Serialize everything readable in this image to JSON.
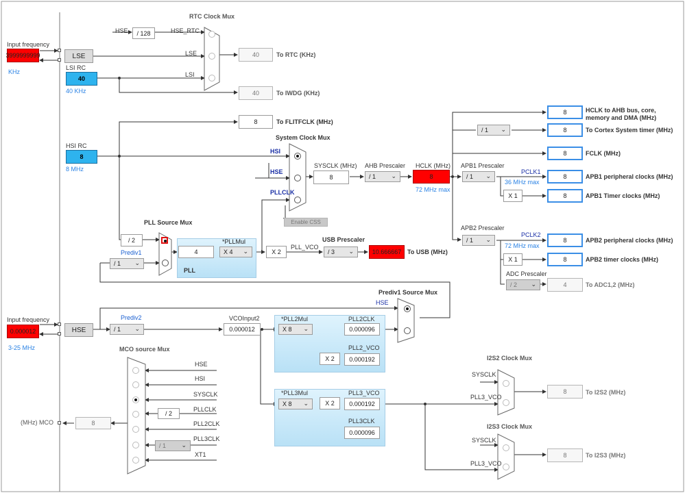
{
  "rtc_mux": {
    "title": "RTC Clock Mux",
    "hse_label": "HSE",
    "hse_div": "/ 128",
    "in_hse_rtc": "HSE_RTC",
    "in_lse": "LSE",
    "in_lsi": "LSI"
  },
  "lse_input": {
    "label": "Input frequency",
    "value": "3999999999",
    "unit": "KHz"
  },
  "lse": {
    "name": "LSE"
  },
  "lsi": {
    "label": "LSI RC",
    "value": "40",
    "freq": "40 KHz"
  },
  "to_rtc": {
    "value": "40",
    "label": "To RTC (KHz)"
  },
  "to_iwdg": {
    "value": "40",
    "label": "To IWDG (KHz)"
  },
  "to_flitf": {
    "value": "8",
    "label": "To FLITFCLK (MHz)"
  },
  "hsi": {
    "label": "HSI RC",
    "value": "8",
    "freq": "8 MHz"
  },
  "sys_mux": {
    "title": "System Clock Mux",
    "in_hsi": "HSI",
    "in_hse": "HSE",
    "in_pllclk": "PLLCLK",
    "enable_css": "Enable CSS"
  },
  "sysclk": {
    "label": "SYSCLK (MHz)",
    "value": "8"
  },
  "ahb": {
    "label": "AHB Prescaler",
    "value": "/ 1"
  },
  "hclk": {
    "label": "HCLK (MHz)",
    "value": "8",
    "max": "72 MHz max"
  },
  "apb1": {
    "label": "APB1 Prescaler",
    "value": "/ 1",
    "pclk": "PCLK1",
    "max": "36 MHz max",
    "timer_mult": "X 1"
  },
  "apb2": {
    "label": "APB2 Prescaler",
    "value": "/ 1",
    "pclk": "PCLK2",
    "max": "72 MHz max",
    "timer_mult": "X 1"
  },
  "systick_div": "/ 1",
  "outputs": {
    "hclk_ahb": {
      "value": "8",
      "label": "HCLK to AHB bus, core,",
      "label2": "memory and DMA (MHz)"
    },
    "cortex_timer": {
      "value": "8",
      "label": "To Cortex System timer (MHz)"
    },
    "fclk": {
      "value": "8",
      "label": "FCLK (MHz)"
    },
    "apb1_periph": {
      "value": "8",
      "label": "APB1 peripheral clocks (MHz)"
    },
    "apb1_timer": {
      "value": "8",
      "label": "APB1 Timer clocks (MHz)"
    },
    "apb2_periph": {
      "value": "8",
      "label": "APB2 peripheral clocks (MHz)"
    },
    "apb2_timer": {
      "value": "8",
      "label": "APB2 timer clocks (MHz)"
    }
  },
  "adc": {
    "label": "ADC Prescaler",
    "value": "/ 2",
    "out_value": "4",
    "out_label": "To ADC1,2 (MHz)"
  },
  "pll_src_mux": {
    "title": "PLL Source Mux",
    "div2": "/ 2",
    "prediv1_label": "Prediv1",
    "prediv1": "/ 1"
  },
  "pll": {
    "title": "PLL",
    "mul_label": "*PLLMul",
    "in_value": "4",
    "mul": "X 4",
    "x2": "X 2",
    "vco_label": "PLL_VCO"
  },
  "usb": {
    "label": "USB Prescaler",
    "value": "/ 3",
    "out_value": "10.666667",
    "out_label": "To USB (MHz)"
  },
  "prediv1_src": {
    "title": "Prediv1 Source Mux",
    "hse": "HSE"
  },
  "hse_input": {
    "label": "Input frequency",
    "value": "0.000012",
    "range": "3-25 MHz"
  },
  "hse": {
    "name": "HSE"
  },
  "prediv2": {
    "label": "Prediv2",
    "value": "/ 1"
  },
  "vco_input2": {
    "label": "VCOInput2",
    "value": "0.000012"
  },
  "pll2": {
    "mul_label": "*PLL2Mul",
    "mul": "X 8",
    "clk_label": "PLL2CLK",
    "clk": "0.000096",
    "x2": "X 2",
    "vco_label": "PLL2_VCO",
    "vco": "0.000192"
  },
  "pll3": {
    "mul_label": "*PLL3Mul",
    "mul": "X 8",
    "x2": "X 2",
    "vco_label": "PLL3_VCO",
    "vco": "0.000192",
    "clk_label": "PLL3CLK",
    "clk": "0.000096"
  },
  "mco_mux": {
    "title": "MCO source Mux",
    "in_hse": "HSE",
    "in_hsi": "HSI",
    "in_sysclk": "SYSCLK",
    "in_pllclk": "PLLCLK",
    "pll_div": "/ 2",
    "in_pll2clk": "PLL2CLK",
    "in_pll3clk": "PLL3CLK",
    "pll3_div": "/ 1",
    "in_xt1": "XT1",
    "out_label": "(MHz) MCO",
    "out_value": "8"
  },
  "i2s2": {
    "title": "I2S2 Clock Mux",
    "in_sys": "SYSCLK",
    "in_pll3": "PLL3_VCO",
    "value": "8",
    "label": "To I2S2 (MHz)"
  },
  "i2s3": {
    "title": "I2S3 Clock Mux",
    "in_sys": "SYSCLK",
    "in_pll3": "PLL3_VCO",
    "value": "8",
    "label": "To I2S3 (MHz)"
  },
  "colors": {
    "accent_red": "#ff0000",
    "accent_cyan": "#2eb3ee",
    "output_border": "#3a8ee6"
  }
}
